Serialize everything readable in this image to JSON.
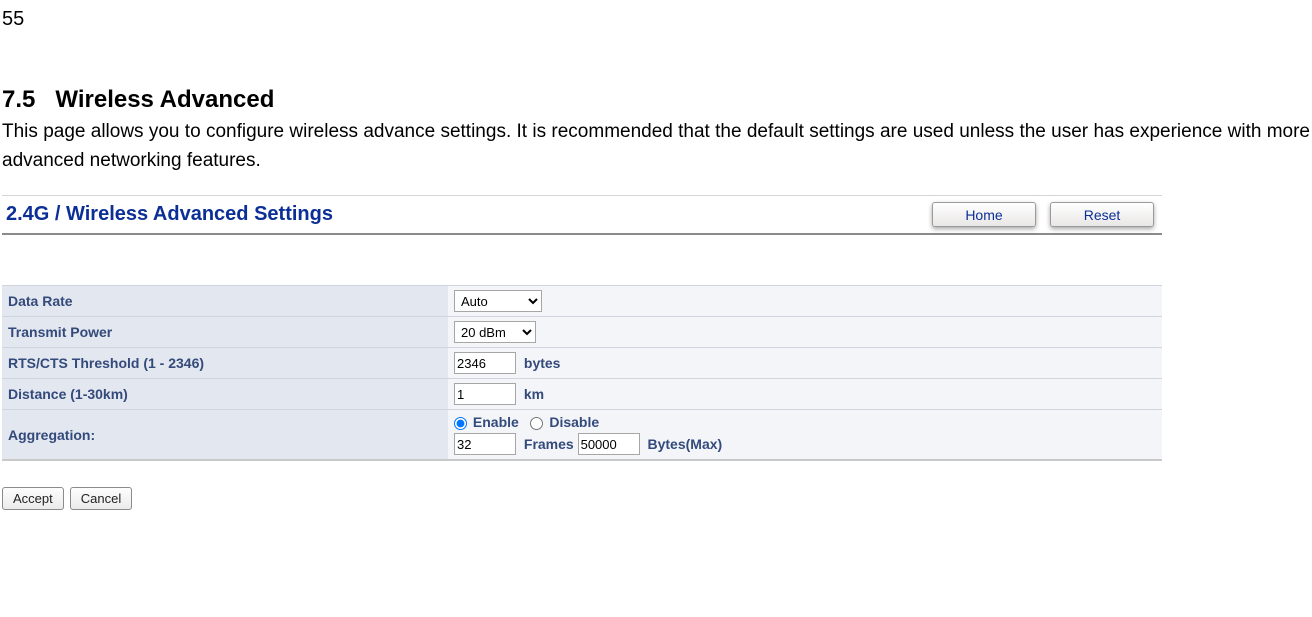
{
  "page_number": "55",
  "section_number": "7.5",
  "section_title": "Wireless Advanced",
  "section_desc": "This page allows you to configure wireless advance settings. It is recommended that the default settings are used unless the user has experience with more advanced networking features.",
  "panel": {
    "title": "2.4G / Wireless Advanced Settings",
    "top_buttons": {
      "home": "Home",
      "reset": "Reset"
    }
  },
  "rows": {
    "data_rate": {
      "label": "Data Rate",
      "value": "Auto"
    },
    "transmit_power": {
      "label": "Transmit Power",
      "value": "20 dBm"
    },
    "rts": {
      "label": "RTS/CTS Threshold (1 - 2346)",
      "value": "2346",
      "unit": "bytes"
    },
    "distance": {
      "label": "Distance (1-30km)",
      "value": "1",
      "unit": "km"
    },
    "aggregation": {
      "label": "Aggregation:",
      "enable": "Enable",
      "disable": "Disable",
      "frames_value": "32",
      "frames_label": "Frames",
      "bytes_value": "50000",
      "bytes_label": "Bytes(Max)"
    }
  },
  "bottom_buttons": {
    "accept": "Accept",
    "cancel": "Cancel"
  }
}
